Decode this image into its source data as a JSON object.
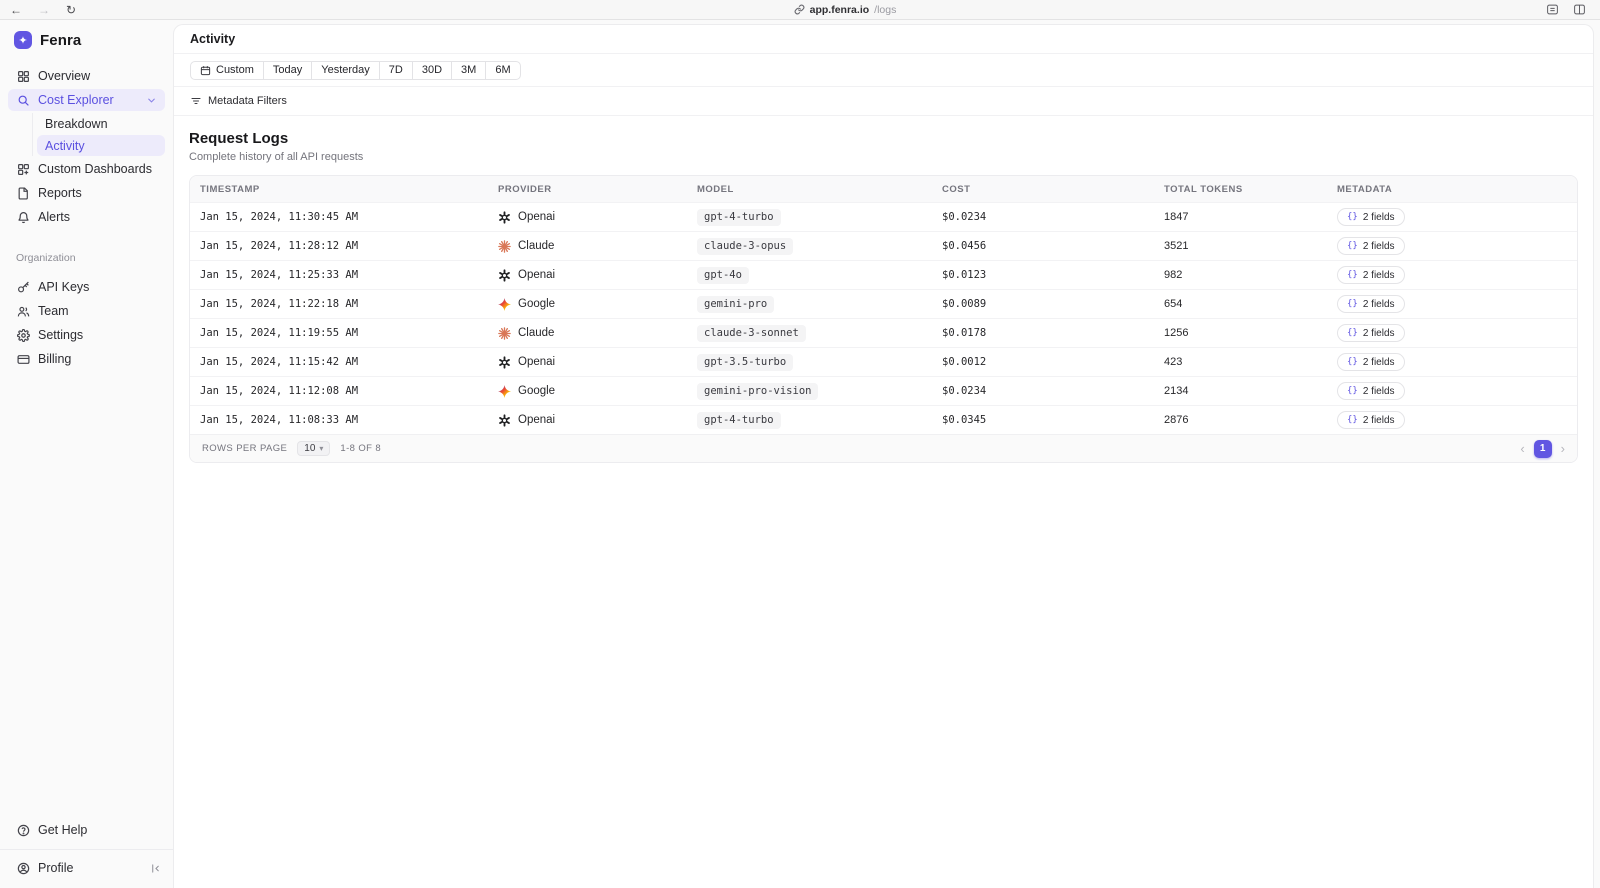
{
  "browser": {
    "url_host": "app.fenra.io",
    "url_path": "/logs"
  },
  "sidebar": {
    "brand": "Fenra",
    "items": [
      {
        "label": "Overview"
      },
      {
        "label": "Cost Explorer"
      },
      {
        "label": "Breakdown"
      },
      {
        "label": "Activity"
      },
      {
        "label": "Custom Dashboards"
      },
      {
        "label": "Reports"
      },
      {
        "label": "Alerts"
      }
    ],
    "section_label": "Organization",
    "org_items": [
      {
        "label": "API Keys"
      },
      {
        "label": "Team"
      },
      {
        "label": "Settings"
      },
      {
        "label": "Billing"
      }
    ],
    "footer": {
      "help_label": "Get Help",
      "profile_label": "Profile"
    }
  },
  "header": {
    "title": "Activity"
  },
  "filters": {
    "ranges": [
      "Custom",
      "Today",
      "Yesterday",
      "7D",
      "30D",
      "3M",
      "6M"
    ],
    "metadata_button": "Metadata Filters"
  },
  "logs": {
    "title": "Request Logs",
    "subtitle": "Complete history of all API requests",
    "columns": [
      "Timestamp",
      "Provider",
      "Model",
      "Cost",
      "Total Tokens",
      "Metadata"
    ],
    "rows": [
      {
        "timestamp": "Jan 15, 2024, 11:30:45 AM",
        "provider": "Openai",
        "provider_icon": "openai",
        "model": "gpt-4-turbo",
        "cost": "$0.0234",
        "tokens": "1847",
        "metadata": "2 fields"
      },
      {
        "timestamp": "Jan 15, 2024, 11:28:12 AM",
        "provider": "Claude",
        "provider_icon": "claude",
        "model": "claude-3-opus",
        "cost": "$0.0456",
        "tokens": "3521",
        "metadata": "2 fields"
      },
      {
        "timestamp": "Jan 15, 2024, 11:25:33 AM",
        "provider": "Openai",
        "provider_icon": "openai",
        "model": "gpt-4o",
        "cost": "$0.0123",
        "tokens": "982",
        "metadata": "2 fields"
      },
      {
        "timestamp": "Jan 15, 2024, 11:22:18 AM",
        "provider": "Google",
        "provider_icon": "google",
        "model": "gemini-pro",
        "cost": "$0.0089",
        "tokens": "654",
        "metadata": "2 fields"
      },
      {
        "timestamp": "Jan 15, 2024, 11:19:55 AM",
        "provider": "Claude",
        "provider_icon": "claude",
        "model": "claude-3-sonnet",
        "cost": "$0.0178",
        "tokens": "1256",
        "metadata": "2 fields"
      },
      {
        "timestamp": "Jan 15, 2024, 11:15:42 AM",
        "provider": "Openai",
        "provider_icon": "openai",
        "model": "gpt-3.5-turbo",
        "cost": "$0.0012",
        "tokens": "423",
        "metadata": "2 fields"
      },
      {
        "timestamp": "Jan 15, 2024, 11:12:08 AM",
        "provider": "Google",
        "provider_icon": "google",
        "model": "gemini-pro-vision",
        "cost": "$0.0234",
        "tokens": "2134",
        "metadata": "2 fields"
      },
      {
        "timestamp": "Jan 15, 2024, 11:08:33 AM",
        "provider": "Openai",
        "provider_icon": "openai",
        "model": "gpt-4-turbo",
        "cost": "$0.0345",
        "tokens": "2876",
        "metadata": "2 fields"
      }
    ],
    "pagination": {
      "rows_per_page_label": "Rows per page",
      "rows_per_page": "10",
      "range_label": "1-8 of 8",
      "page": "1"
    }
  },
  "colors": {
    "accent": "#6156e2",
    "accent_bg": "#edebfb",
    "claude_orange": "#d97757",
    "openai_dark": "#202123"
  }
}
